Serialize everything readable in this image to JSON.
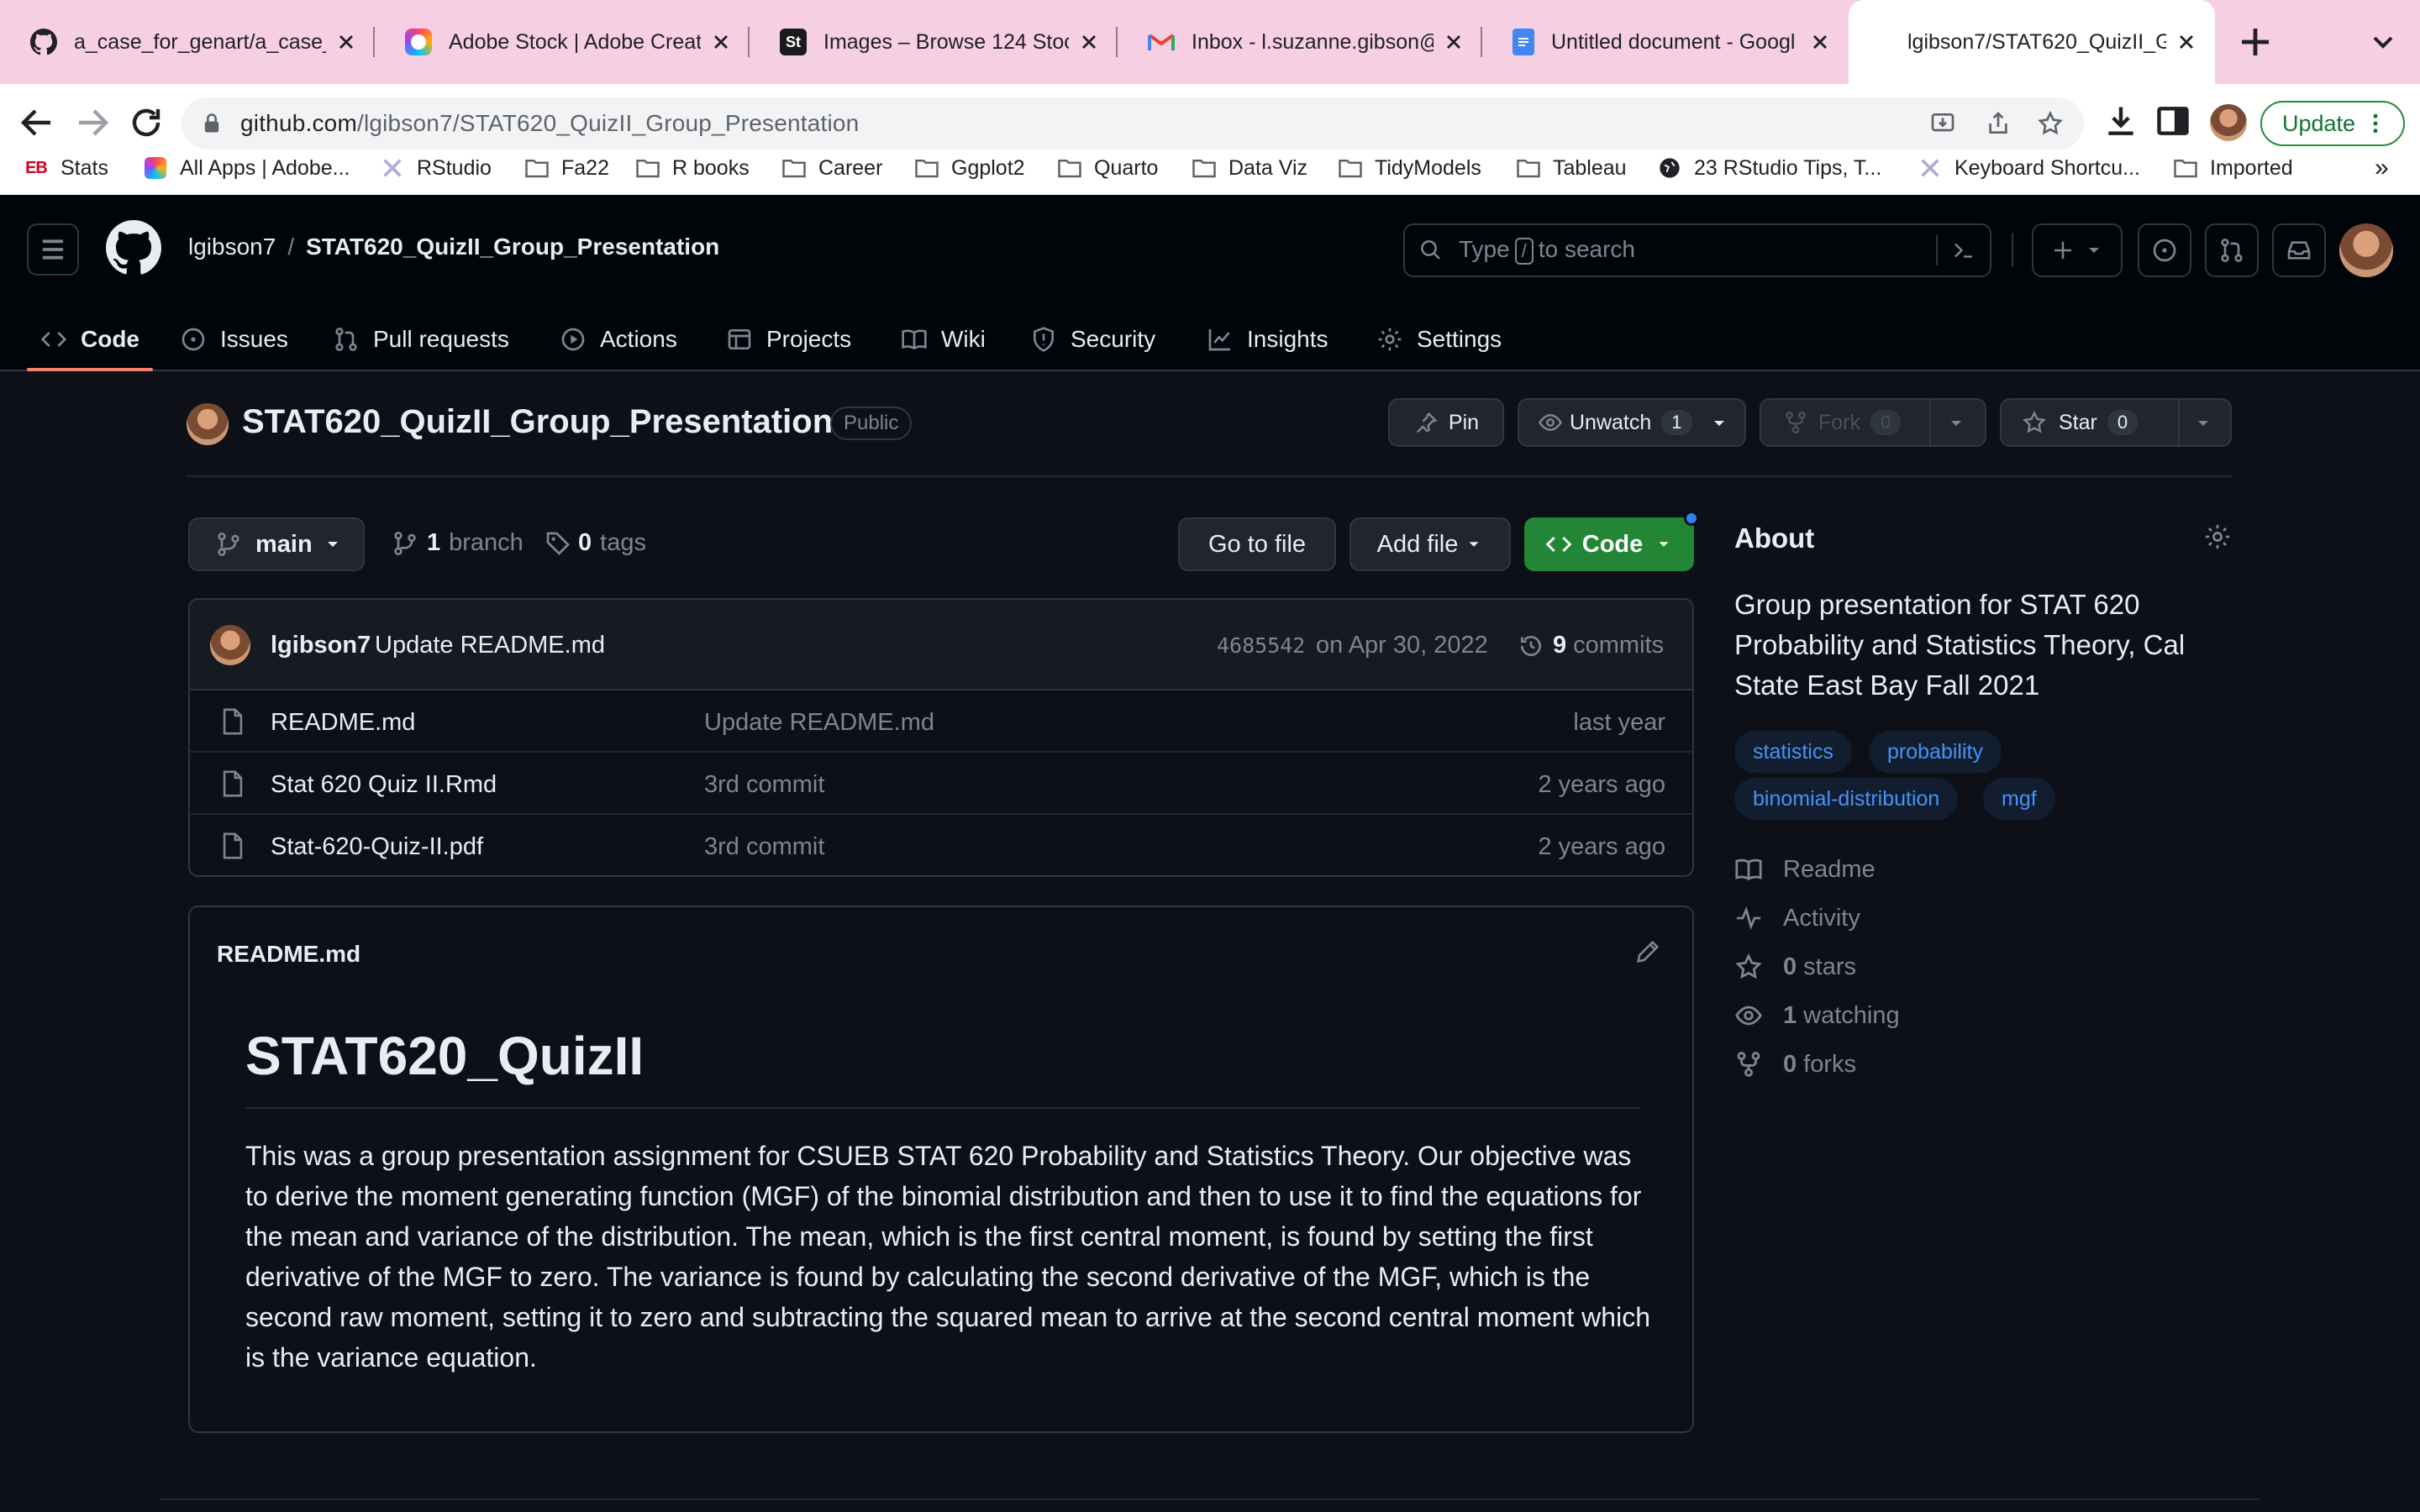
{
  "browser": {
    "tabs": [
      {
        "title": "a_case_for_genart/a_case_",
        "icon": "github-favicon"
      },
      {
        "title": "Adobe Stock | Adobe Creat",
        "icon": "adobe-favicon"
      },
      {
        "title": "Images – Browse 124 Stock",
        "icon": "adobe-stock-favicon"
      },
      {
        "title": "Inbox - l.suzanne.gibson@g",
        "icon": "gmail-favicon"
      },
      {
        "title": "Untitled document - Googl",
        "icon": "google-docs-favicon"
      },
      {
        "title": "lgibson7/STAT620_QuizII_G",
        "icon": "none"
      }
    ],
    "url_host": "github.com",
    "url_path": "/lgibson7/STAT620_QuizII_Group_Presentation",
    "update_label": "Update",
    "bookmarks": [
      {
        "label": "Stats",
        "icon": "eb-logo"
      },
      {
        "label": "All Apps | Adobe...",
        "icon": "adobe-icon"
      },
      {
        "label": "RStudio",
        "icon": "rstudio-icon"
      },
      {
        "label": "Fa22",
        "icon": "folder-icon"
      },
      {
        "label": "R books",
        "icon": "folder-icon"
      },
      {
        "label": "Career",
        "icon": "folder-icon"
      },
      {
        "label": "Ggplot2",
        "icon": "folder-icon"
      },
      {
        "label": "Quarto",
        "icon": "folder-icon"
      },
      {
        "label": "Data Viz",
        "icon": "folder-icon"
      },
      {
        "label": "TidyModels",
        "icon": "folder-icon"
      },
      {
        "label": "Tableau",
        "icon": "folder-icon"
      },
      {
        "label": "23 RStudio Tips, T...",
        "icon": "globe-icon"
      },
      {
        "label": "Keyboard Shortcu...",
        "icon": "rstudio-icon"
      },
      {
        "label": "Imported",
        "icon": "folder-icon"
      }
    ],
    "bookmarks_overflow": "»"
  },
  "github": {
    "owner": "lgibson7",
    "separator": "/",
    "repo": "STAT620_QuizII_Group_Presentation",
    "search_prefix": "Type",
    "search_key": "/",
    "search_suffix": "to search",
    "nav": [
      "Code",
      "Issues",
      "Pull requests",
      "Actions",
      "Projects",
      "Wiki",
      "Security",
      "Insights",
      "Settings"
    ],
    "visibility": "Public",
    "pin_label": "Pin",
    "unwatch_label": "Unwatch",
    "watch_count": "1",
    "fork_label": "Fork",
    "fork_count": "0",
    "star_label": "Star",
    "star_count": "0"
  },
  "files": {
    "branch": "main",
    "branch_count": "1",
    "branch_label": "branch",
    "tag_count": "0",
    "tag_label": "tags",
    "go_to_file": "Go to file",
    "add_file": "Add file",
    "code_label": "Code",
    "latest_commit": {
      "author": "lgibson7",
      "message": "Update README.md",
      "sha": "4685542",
      "date": "on Apr 30, 2022",
      "commit_count": "9",
      "commit_label": "commits"
    },
    "rows": [
      {
        "name": "README.md",
        "message": "Update README.md",
        "age": "last year"
      },
      {
        "name": "Stat 620 Quiz II.Rmd",
        "message": "3rd commit",
        "age": "2 years ago"
      },
      {
        "name": "Stat-620-Quiz-II.pdf",
        "message": "3rd commit",
        "age": "2 years ago"
      }
    ]
  },
  "readme": {
    "file_label": "README.md",
    "heading": "STAT620_QuizII",
    "body": "This was a group presentation assignment for CSUEB STAT 620 Probability and Statistics Theory. Our objective was to derive the moment generating function (MGF) of the binomial distribution and then to use it to find the equations for the mean and variance of the distribution. The mean, which is the first central moment, is found by setting the first derivative of the MGF to zero. The variance is found by calculating the second derivative of the MGF, which is the second raw moment, setting it to zero and subtracting the squared mean to arrive at the second central moment which is the variance equation."
  },
  "about": {
    "heading": "About",
    "description": "Group presentation for STAT 620 Probability and Statistics Theory, Cal State East Bay Fall 2021",
    "topics": [
      "statistics",
      "probability",
      "binomial-distribution",
      "mgf"
    ],
    "readme_label": "Readme",
    "activity_label": "Activity",
    "stars_count": "0",
    "stars_label": "stars",
    "watching_count": "1",
    "watching_label": "watching",
    "forks_count": "0",
    "forks_label": "forks"
  },
  "colors": {
    "page_bg": "#0d1117",
    "header_bg": "#010409",
    "accent_green": "#238636",
    "link_blue": "#4493f8",
    "tab_strip": "#f6cfe2",
    "active_underline": "#f78166"
  }
}
